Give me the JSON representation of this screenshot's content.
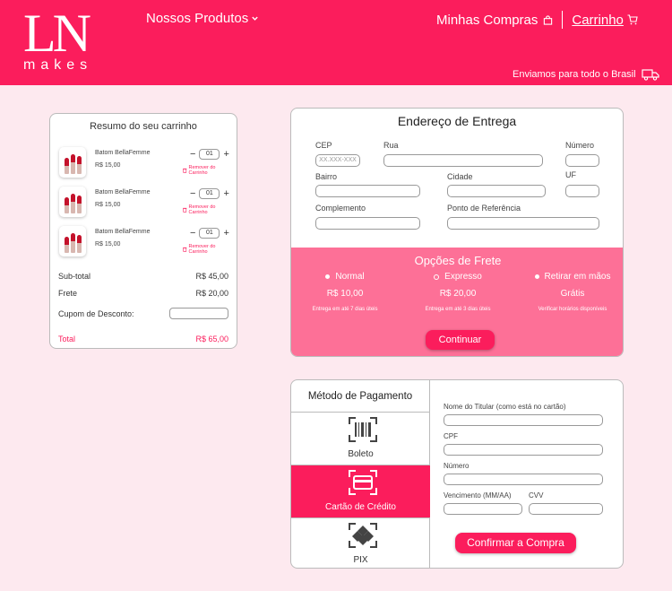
{
  "brand": {
    "mark": "LN",
    "word": "makes"
  },
  "nav": {
    "products": "Nossos Produtos",
    "purchases": "Minhas Compras",
    "cart": "Carrinho",
    "shipping_note": "Enviamos para todo o Brasil"
  },
  "cart": {
    "title": "Resumo do seu carrinho",
    "items": [
      {
        "name": "Batom BellaFemme",
        "price": "R$ 15,00",
        "qty": "01",
        "remove": "Remover do Carrinho"
      },
      {
        "name": "Batom BellaFemme",
        "price": "R$ 15,00",
        "qty": "01",
        "remove": "Remover do Carrinho"
      },
      {
        "name": "Batom BellaFemme",
        "price": "R$ 15,00",
        "qty": "01",
        "remove": "Remover do Carrinho"
      }
    ],
    "subtotal_label": "Sub-total",
    "subtotal": "R$ 45,00",
    "freight_label": "Frete",
    "freight": "R$ 20,00",
    "coupon_label": "Cupom de Desconto:",
    "total_label": "Total",
    "total": "R$ 65,00"
  },
  "address": {
    "title": "Endereço de Entrega",
    "cep": "CEP",
    "cep_placeholder": "XX.XXX-XXX",
    "street": "Rua",
    "number": "Número",
    "district": "Bairro",
    "city": "Cidade",
    "state": "UF",
    "complement": "Complemento",
    "reference": "Ponto de Referência"
  },
  "freight": {
    "title": "Opções de Frete",
    "options": [
      {
        "name": "Normal",
        "price": "R$ 10,00",
        "note": "Entrega em até 7 dias úteis"
      },
      {
        "name": "Expresso",
        "price": "R$ 20,00",
        "note": "Entrega em até 3 dias úteis"
      },
      {
        "name": "Retirar em mãos",
        "price": "Grátis",
        "note": "Verificar horários disponíveis"
      }
    ],
    "selected": "Expresso",
    "continue": "Continuar"
  },
  "payment": {
    "title": "Método de Pagamento",
    "methods": [
      {
        "label": "Boleto",
        "icon": "barcode-icon"
      },
      {
        "label": "Cartão de Crédito",
        "icon": "credit-card-icon"
      },
      {
        "label": "PIX",
        "icon": "pix-icon"
      }
    ],
    "active": "Cartão de Crédito",
    "holder_label": "Nome do Titular (como está no cartão)",
    "cpf_label": "CPF",
    "number_label": "Número",
    "expiry_label": "Vencimento (MM/AA)",
    "cvv_label": "CVV",
    "confirm": "Confirmar a Compra"
  },
  "colors": {
    "primary": "#fb1d5c",
    "freight_bg": "#fd7097",
    "page_bg": "#fde9ef"
  }
}
